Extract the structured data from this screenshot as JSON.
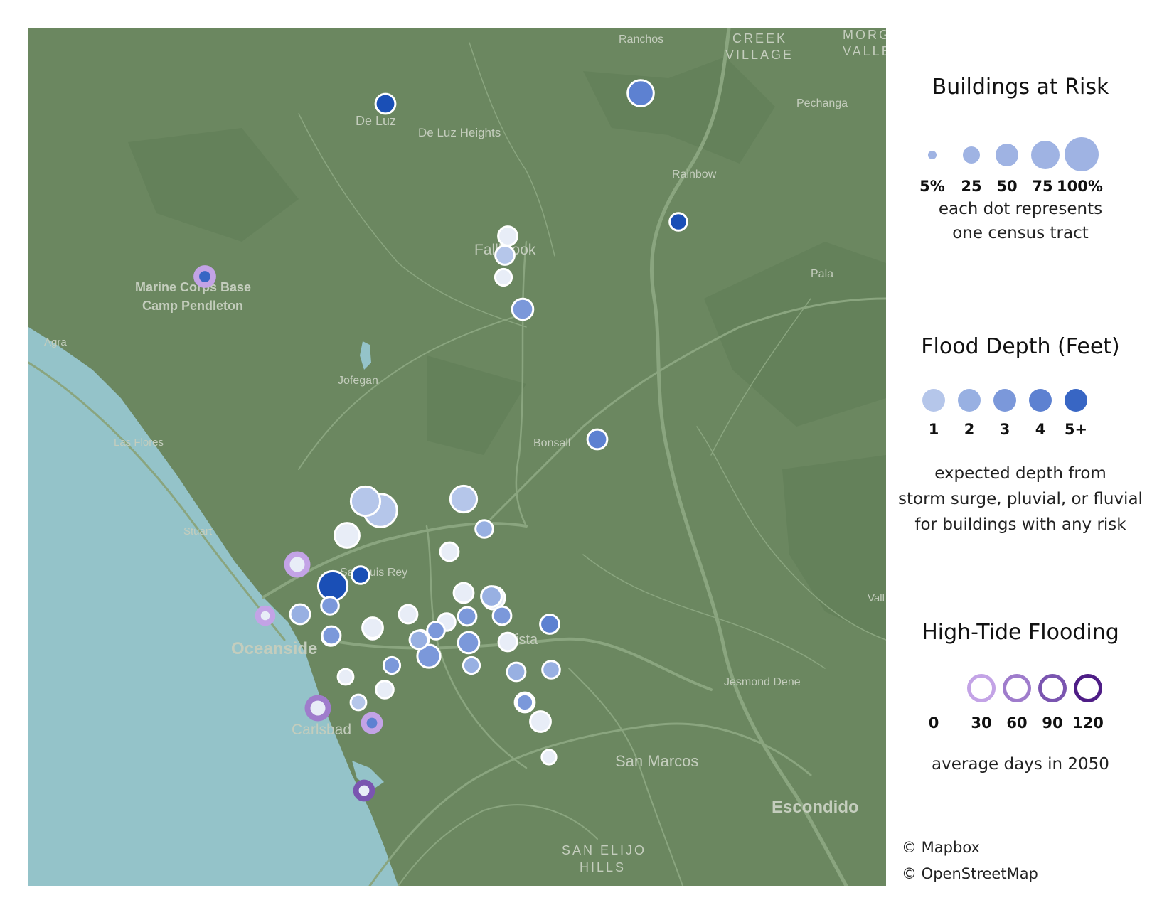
{
  "map": {
    "colors": {
      "land": "#6b8760",
      "water": "#94c3c9",
      "roads": "#8aa57f",
      "label": "#c4cdbd"
    },
    "places": [
      {
        "name": "Ranchos"
      },
      {
        "name": "CREEK"
      },
      {
        "name": "VILLAGE"
      },
      {
        "name": "MORGA"
      },
      {
        "name": "VALLE"
      },
      {
        "name": "Pechanga"
      },
      {
        "name": "De Luz"
      },
      {
        "name": "De Luz Heights"
      },
      {
        "name": "Rainbow"
      },
      {
        "name": "Fallbrook"
      },
      {
        "name": "Pala"
      },
      {
        "name": "Marine Corps Base"
      },
      {
        "name": "Camp Pendleton"
      },
      {
        "name": "Agra"
      },
      {
        "name": "Jofegan"
      },
      {
        "name": "Las Flores"
      },
      {
        "name": "Bonsall"
      },
      {
        "name": "Stuart"
      },
      {
        "name": "San Luis Rey"
      },
      {
        "name": "Vall"
      },
      {
        "name": "Oceanside"
      },
      {
        "name": "Vista"
      },
      {
        "name": "Jesmond Dene"
      },
      {
        "name": "Carlsbad"
      },
      {
        "name": "San Marcos"
      },
      {
        "name": "Escondido"
      },
      {
        "name": "SAN ELIJO"
      },
      {
        "name": "HILLS"
      }
    ],
    "depth_colors": [
      "#e8edf7",
      "#b5c6ea",
      "#98b0e2",
      "#7b98da",
      "#5d81d1",
      "#3866c4",
      "#1a4fb6"
    ],
    "tracts": [
      {
        "risk_pct": 18,
        "depth": 6
      },
      {
        "risk_pct": 40,
        "depth": 4
      },
      {
        "risk_pct": 12,
        "depth": 6
      },
      {
        "risk_pct": 16,
        "depth": 0
      },
      {
        "risk_pct": 16,
        "depth": 1
      },
      {
        "risk_pct": 10,
        "depth": 0
      },
      {
        "risk_pct": 22,
        "depth": 3
      },
      {
        "risk_pct": 18,
        "depth": 4
      },
      {
        "risk_pct": 42,
        "depth": 1
      },
      {
        "risk_pct": 75,
        "depth": 1
      },
      {
        "risk_pct": 55,
        "depth": 1
      },
      {
        "risk_pct": 35,
        "depth": 0
      },
      {
        "risk_pct": 12,
        "depth": 2
      },
      {
        "risk_pct": 14,
        "depth": 0
      },
      {
        "risk_pct": 55,
        "depth": 6
      },
      {
        "risk_pct": 12,
        "depth": 6
      },
      {
        "risk_pct": 12,
        "depth": 3
      },
      {
        "risk_pct": 18,
        "depth": 2
      },
      {
        "risk_pct": 14,
        "depth": 0
      },
      {
        "risk_pct": 18,
        "depth": 0
      },
      {
        "risk_pct": 28,
        "depth": 0
      },
      {
        "risk_pct": 20,
        "depth": 2
      },
      {
        "risk_pct": 14,
        "depth": 3
      },
      {
        "risk_pct": 14,
        "depth": 3
      },
      {
        "risk_pct": 12,
        "depth": 0
      },
      {
        "risk_pct": 12,
        "depth": 3
      },
      {
        "risk_pct": 10,
        "depth": 0
      },
      {
        "risk_pct": 12,
        "depth": 2
      },
      {
        "risk_pct": 12,
        "depth": 2
      },
      {
        "risk_pct": 28,
        "depth": 3
      },
      {
        "risk_pct": 14,
        "depth": 1
      },
      {
        "risk_pct": 22,
        "depth": 3
      },
      {
        "risk_pct": 16,
        "depth": 4
      },
      {
        "risk_pct": 14,
        "depth": 0
      },
      {
        "risk_pct": 12,
        "depth": 2
      },
      {
        "risk_pct": 10,
        "depth": 2
      },
      {
        "risk_pct": 10,
        "depth": 3
      },
      {
        "risk_pct": 8,
        "depth": 0
      },
      {
        "risk_pct": 14,
        "depth": 2
      },
      {
        "risk_pct": 18,
        "depth": 3
      },
      {
        "risk_pct": 18,
        "depth": 1
      },
      {
        "risk_pct": 6,
        "depth": 0
      },
      {
        "risk_pct": 14,
        "depth": 3
      },
      {
        "risk_pct": 8,
        "depth": 1
      },
      {
        "risk_pct": 20,
        "depth": 0
      },
      {
        "risk_pct": 12,
        "depth": 0
      },
      {
        "risk_pct": 20,
        "depth": 0
      },
      {
        "risk_pct": 10,
        "depth": 3
      },
      {
        "risk_pct": 14,
        "depth": 2
      }
    ],
    "tide_colors": [
      "#d8c4f2",
      "#c3a3e6",
      "#9f7ccc",
      "#7a55b0",
      "#4e1d86"
    ],
    "tide_tracts": [
      {
        "risk_pct": 18,
        "depth": 5,
        "tide_days": 30
      },
      {
        "risk_pct": 30,
        "depth": 0,
        "tide_days": 30
      },
      {
        "risk_pct": 12,
        "depth": 0,
        "tide_days": 30
      },
      {
        "risk_pct": 30,
        "depth": 0,
        "tide_days": 45
      },
      {
        "risk_pct": 16,
        "depth": 4,
        "tide_days": 30
      },
      {
        "risk_pct": 16,
        "depth": 0,
        "tide_days": 90
      }
    ]
  },
  "legend": {
    "buildings": {
      "title": "Buildings at Risk",
      "sizes": [
        {
          "label": "5%"
        },
        {
          "label": "25"
        },
        {
          "label": "50"
        },
        {
          "label": "75"
        },
        {
          "label": "100%"
        }
      ],
      "note_line1": "each dot represents",
      "note_line2": "one census tract",
      "symbol_color": "#9fb3e3"
    },
    "depth": {
      "title": "Flood Depth (Feet)",
      "levels": [
        {
          "label": "1",
          "color": "#b5c6ea"
        },
        {
          "label": "2",
          "color": "#98b0e2"
        },
        {
          "label": "3",
          "color": "#7b98da"
        },
        {
          "label": "4",
          "color": "#5d81d1"
        },
        {
          "label": "5+",
          "color": "#3866c4"
        }
      ],
      "note_line1": "expected depth from",
      "note_line2": "storm surge, pluvial, or fluvial",
      "note_line3": "for buildings with any risk"
    },
    "tide": {
      "title": "High-Tide Flooding",
      "levels": [
        {
          "label": "0",
          "color": ""
        },
        {
          "label": "30",
          "color": "#c3a3e6"
        },
        {
          "label": "60",
          "color": "#9f7ccc"
        },
        {
          "label": "90",
          "color": "#7a55b0"
        },
        {
          "label": "120",
          "color": "#4e1d86"
        }
      ],
      "note": "average days in 2050"
    }
  },
  "attribution": {
    "mapbox": "© Mapbox",
    "osm": "© OpenStreetMap"
  }
}
